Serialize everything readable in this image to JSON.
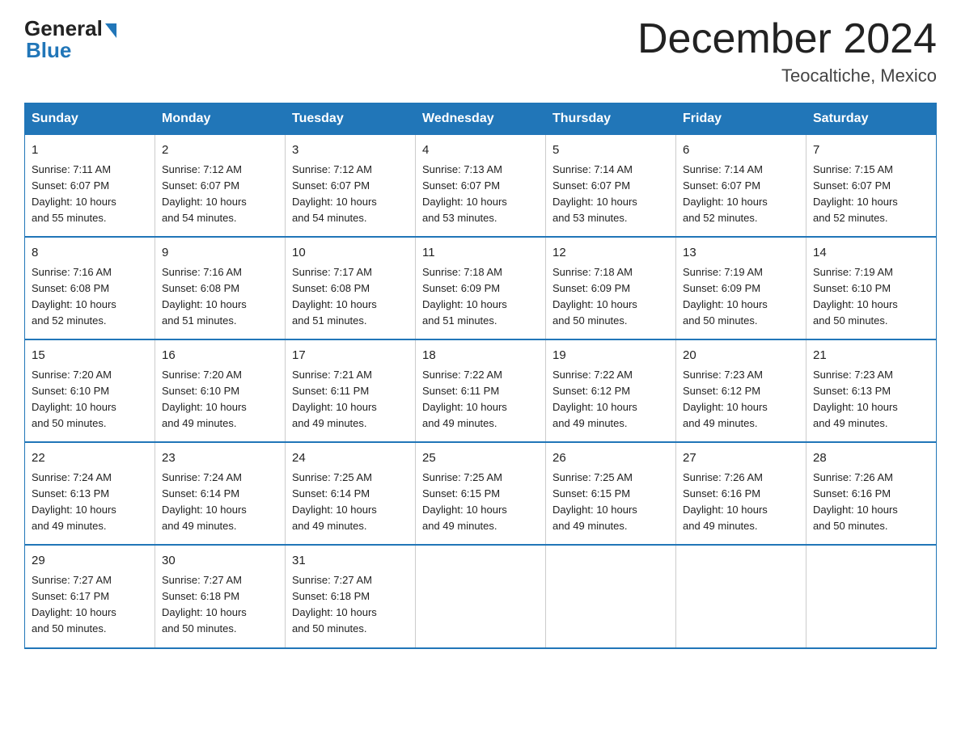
{
  "logo": {
    "general": "General",
    "blue": "Blue"
  },
  "title": "December 2024",
  "location": "Teocaltiche, Mexico",
  "days_of_week": [
    "Sunday",
    "Monday",
    "Tuesday",
    "Wednesday",
    "Thursday",
    "Friday",
    "Saturday"
  ],
  "weeks": [
    [
      {
        "day": "1",
        "sunrise": "7:11 AM",
        "sunset": "6:07 PM",
        "daylight": "10 hours and 55 minutes."
      },
      {
        "day": "2",
        "sunrise": "7:12 AM",
        "sunset": "6:07 PM",
        "daylight": "10 hours and 54 minutes."
      },
      {
        "day": "3",
        "sunrise": "7:12 AM",
        "sunset": "6:07 PM",
        "daylight": "10 hours and 54 minutes."
      },
      {
        "day": "4",
        "sunrise": "7:13 AM",
        "sunset": "6:07 PM",
        "daylight": "10 hours and 53 minutes."
      },
      {
        "day": "5",
        "sunrise": "7:14 AM",
        "sunset": "6:07 PM",
        "daylight": "10 hours and 53 minutes."
      },
      {
        "day": "6",
        "sunrise": "7:14 AM",
        "sunset": "6:07 PM",
        "daylight": "10 hours and 52 minutes."
      },
      {
        "day": "7",
        "sunrise": "7:15 AM",
        "sunset": "6:07 PM",
        "daylight": "10 hours and 52 minutes."
      }
    ],
    [
      {
        "day": "8",
        "sunrise": "7:16 AM",
        "sunset": "6:08 PM",
        "daylight": "10 hours and 52 minutes."
      },
      {
        "day": "9",
        "sunrise": "7:16 AM",
        "sunset": "6:08 PM",
        "daylight": "10 hours and 51 minutes."
      },
      {
        "day": "10",
        "sunrise": "7:17 AM",
        "sunset": "6:08 PM",
        "daylight": "10 hours and 51 minutes."
      },
      {
        "day": "11",
        "sunrise": "7:18 AM",
        "sunset": "6:09 PM",
        "daylight": "10 hours and 51 minutes."
      },
      {
        "day": "12",
        "sunrise": "7:18 AM",
        "sunset": "6:09 PM",
        "daylight": "10 hours and 50 minutes."
      },
      {
        "day": "13",
        "sunrise": "7:19 AM",
        "sunset": "6:09 PM",
        "daylight": "10 hours and 50 minutes."
      },
      {
        "day": "14",
        "sunrise": "7:19 AM",
        "sunset": "6:10 PM",
        "daylight": "10 hours and 50 minutes."
      }
    ],
    [
      {
        "day": "15",
        "sunrise": "7:20 AM",
        "sunset": "6:10 PM",
        "daylight": "10 hours and 50 minutes."
      },
      {
        "day": "16",
        "sunrise": "7:20 AM",
        "sunset": "6:10 PM",
        "daylight": "10 hours and 49 minutes."
      },
      {
        "day": "17",
        "sunrise": "7:21 AM",
        "sunset": "6:11 PM",
        "daylight": "10 hours and 49 minutes."
      },
      {
        "day": "18",
        "sunrise": "7:22 AM",
        "sunset": "6:11 PM",
        "daylight": "10 hours and 49 minutes."
      },
      {
        "day": "19",
        "sunrise": "7:22 AM",
        "sunset": "6:12 PM",
        "daylight": "10 hours and 49 minutes."
      },
      {
        "day": "20",
        "sunrise": "7:23 AM",
        "sunset": "6:12 PM",
        "daylight": "10 hours and 49 minutes."
      },
      {
        "day": "21",
        "sunrise": "7:23 AM",
        "sunset": "6:13 PM",
        "daylight": "10 hours and 49 minutes."
      }
    ],
    [
      {
        "day": "22",
        "sunrise": "7:24 AM",
        "sunset": "6:13 PM",
        "daylight": "10 hours and 49 minutes."
      },
      {
        "day": "23",
        "sunrise": "7:24 AM",
        "sunset": "6:14 PM",
        "daylight": "10 hours and 49 minutes."
      },
      {
        "day": "24",
        "sunrise": "7:25 AM",
        "sunset": "6:14 PM",
        "daylight": "10 hours and 49 minutes."
      },
      {
        "day": "25",
        "sunrise": "7:25 AM",
        "sunset": "6:15 PM",
        "daylight": "10 hours and 49 minutes."
      },
      {
        "day": "26",
        "sunrise": "7:25 AM",
        "sunset": "6:15 PM",
        "daylight": "10 hours and 49 minutes."
      },
      {
        "day": "27",
        "sunrise": "7:26 AM",
        "sunset": "6:16 PM",
        "daylight": "10 hours and 49 minutes."
      },
      {
        "day": "28",
        "sunrise": "7:26 AM",
        "sunset": "6:16 PM",
        "daylight": "10 hours and 50 minutes."
      }
    ],
    [
      {
        "day": "29",
        "sunrise": "7:27 AM",
        "sunset": "6:17 PM",
        "daylight": "10 hours and 50 minutes."
      },
      {
        "day": "30",
        "sunrise": "7:27 AM",
        "sunset": "6:18 PM",
        "daylight": "10 hours and 50 minutes."
      },
      {
        "day": "31",
        "sunrise": "7:27 AM",
        "sunset": "6:18 PM",
        "daylight": "10 hours and 50 minutes."
      },
      null,
      null,
      null,
      null
    ]
  ],
  "labels": {
    "sunrise": "Sunrise:",
    "sunset": "Sunset:",
    "daylight": "Daylight:"
  }
}
